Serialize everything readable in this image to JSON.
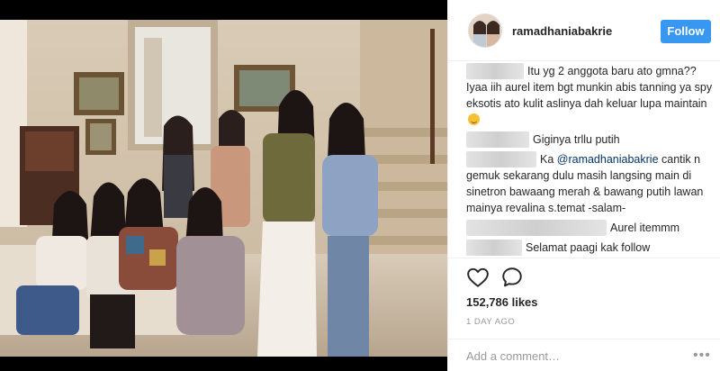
{
  "post": {
    "username": "ramadhaniabakrie",
    "follow_label": "Follow",
    "likes": "152,786 likes",
    "time_ago": "1 DAY AGO",
    "add_comment_placeholder": "Add a comment…",
    "more_label": "•••"
  },
  "comments": [
    {
      "text": "Itu yg 2 anggota baru ato gmna?? Iyaa iih aurel item bgt munkin abis tanning ya spy eksotis ato kulit aslinya dah keluar lupa maintain",
      "emoji": "grinning-face-emoji"
    },
    {
      "text": "Giginya trllu putih"
    },
    {
      "text_pre": "Ka ",
      "mention": "@ramadhaniabakrie",
      "text_post": " cantik n gemuk sekarang dulu masih langsing main di sinetron bawaang merah & bawang putih lawan mainya revalina s.temat -salam-"
    },
    {
      "text": "Aurel itemmm"
    },
    {
      "text": "Selamat paagi kak follow"
    }
  ],
  "icons": {
    "like": "heart-icon",
    "comment": "speech-bubble-icon"
  },
  "colors": {
    "follow_button": "#3897f0",
    "mention": "#003569",
    "timestamp": "#999999"
  }
}
